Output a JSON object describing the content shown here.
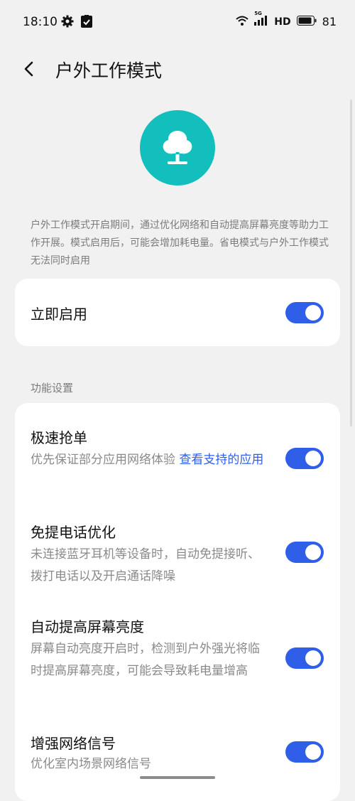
{
  "status_bar": {
    "time": "18:10",
    "network_labels": "5G",
    "hd": "HD",
    "battery": "81"
  },
  "header": {
    "title": "户外工作模式"
  },
  "hero": {
    "icon": "tree-icon",
    "color": "#12bfbd"
  },
  "intro": {
    "text": "户外工作模式开启期间，通过优化网络和自动提高屏幕亮度等助力工作开展。模式启用后，可能会增加耗电量。省电模式与户外工作模式无法同时启用"
  },
  "enable": {
    "label": "立即启用",
    "on": true
  },
  "features": {
    "section_label": "功能设置",
    "items": [
      {
        "title": "极速抢单",
        "desc": "优先保证部分应用网络体验",
        "link": "查看支持的应用",
        "on": true
      },
      {
        "title": "免提电话优化",
        "desc": "未连接蓝牙耳机等设备时，自动免提接听、拨打电话以及开启通话降噪",
        "on": true
      },
      {
        "title": "自动提高屏幕亮度",
        "desc": "屏幕自动亮度开启时，检测到户外强光将临时提高屏幕亮度，可能会导致耗电量增高",
        "on": true
      },
      {
        "title": "增强网络信号",
        "desc": "优化室内场景网络信号",
        "on": true
      }
    ]
  },
  "colors": {
    "accent": "#2f5fe8",
    "background": "#f1f1f1"
  }
}
